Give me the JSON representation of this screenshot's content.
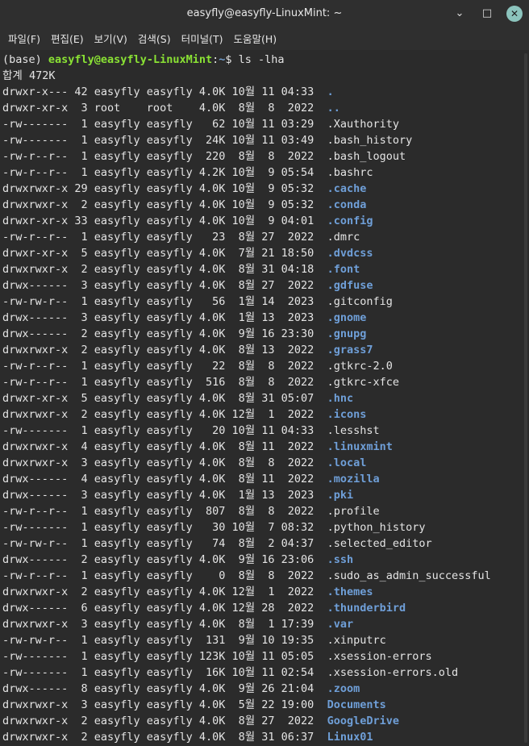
{
  "window": {
    "title": "easyfly@easyfly-LinuxMint: ~",
    "minimize_glyph": "⌄",
    "maximize_glyph": "□",
    "close_glyph": "✕"
  },
  "menu": [
    "파일(F)",
    "편집(E)",
    "보기(V)",
    "검색(S)",
    "터미널(T)",
    "도움말(H)"
  ],
  "prompt": {
    "env": "(base) ",
    "userhost": "easyfly@easyfly-LinuxMint",
    "colon": ":",
    "path": "~",
    "dollar": "$ ",
    "command": "ls -lha"
  },
  "total": "합계 472K",
  "colors": {
    "dir": "#6f9fd8",
    "user": "#8ae234",
    "bg": "#2b2b2b",
    "fg": "#e4e4e4"
  },
  "entries": [
    {
      "meta": "drwxr-x--- 42 easyfly easyfly 4.0K 10월 11 04:33  ",
      "name": ".",
      "dir": true
    },
    {
      "meta": "drwxr-xr-x  3 root    root    4.0K  8월  8  2022  ",
      "name": "..",
      "dir": true
    },
    {
      "meta": "-rw-------  1 easyfly easyfly   62 10월 11 03:29  ",
      "name": ".Xauthority",
      "dir": false
    },
    {
      "meta": "-rw-------  1 easyfly easyfly  24K 10월 11 03:49  ",
      "name": ".bash_history",
      "dir": false
    },
    {
      "meta": "-rw-r--r--  1 easyfly easyfly  220  8월  8  2022  ",
      "name": ".bash_logout",
      "dir": false
    },
    {
      "meta": "-rw-r--r--  1 easyfly easyfly 4.2K 10월  9 05:54  ",
      "name": ".bashrc",
      "dir": false
    },
    {
      "meta": "drwxrwxr-x 29 easyfly easyfly 4.0K 10월  9 05:32  ",
      "name": ".cache",
      "dir": true
    },
    {
      "meta": "drwxrwxr-x  2 easyfly easyfly 4.0K 10월  9 05:32  ",
      "name": ".conda",
      "dir": true
    },
    {
      "meta": "drwxr-xr-x 33 easyfly easyfly 4.0K 10월  9 04:01  ",
      "name": ".config",
      "dir": true
    },
    {
      "meta": "-rw-r--r--  1 easyfly easyfly   23  8월 27  2022  ",
      "name": ".dmrc",
      "dir": false
    },
    {
      "meta": "drwxr-xr-x  5 easyfly easyfly 4.0K  7월 21 18:50  ",
      "name": ".dvdcss",
      "dir": true
    },
    {
      "meta": "drwxrwxr-x  2 easyfly easyfly 4.0K  8월 31 04:18  ",
      "name": ".font",
      "dir": true
    },
    {
      "meta": "drwx------  3 easyfly easyfly 4.0K  8월 27  2022  ",
      "name": ".gdfuse",
      "dir": true
    },
    {
      "meta": "-rw-rw-r--  1 easyfly easyfly   56  1월 14  2023  ",
      "name": ".gitconfig",
      "dir": false
    },
    {
      "meta": "drwx------  3 easyfly easyfly 4.0K  1월 13  2023  ",
      "name": ".gnome",
      "dir": true
    },
    {
      "meta": "drwx------  2 easyfly easyfly 4.0K  9월 16 23:30  ",
      "name": ".gnupg",
      "dir": true
    },
    {
      "meta": "drwxrwxr-x  2 easyfly easyfly 4.0K  8월 13  2022  ",
      "name": ".grass7",
      "dir": true
    },
    {
      "meta": "-rw-r--r--  1 easyfly easyfly   22  8월  8  2022  ",
      "name": ".gtkrc-2.0",
      "dir": false
    },
    {
      "meta": "-rw-r--r--  1 easyfly easyfly  516  8월  8  2022  ",
      "name": ".gtkrc-xfce",
      "dir": false
    },
    {
      "meta": "drwxr-xr-x  5 easyfly easyfly 4.0K  8월 31 05:07  ",
      "name": ".hnc",
      "dir": true
    },
    {
      "meta": "drwxrwxr-x  2 easyfly easyfly 4.0K 12월  1  2022  ",
      "name": ".icons",
      "dir": true
    },
    {
      "meta": "-rw-------  1 easyfly easyfly   20 10월 11 04:33  ",
      "name": ".lesshst",
      "dir": false
    },
    {
      "meta": "drwxrwxr-x  4 easyfly easyfly 4.0K  8월 11  2022  ",
      "name": ".linuxmint",
      "dir": true
    },
    {
      "meta": "drwxrwxr-x  3 easyfly easyfly 4.0K  8월  8  2022  ",
      "name": ".local",
      "dir": true
    },
    {
      "meta": "drwx------  4 easyfly easyfly 4.0K  8월 11  2022  ",
      "name": ".mozilla",
      "dir": true
    },
    {
      "meta": "drwx------  3 easyfly easyfly 4.0K  1월 13  2023  ",
      "name": ".pki",
      "dir": true
    },
    {
      "meta": "-rw-r--r--  1 easyfly easyfly  807  8월  8  2022  ",
      "name": ".profile",
      "dir": false
    },
    {
      "meta": "-rw-------  1 easyfly easyfly   30 10월  7 08:32  ",
      "name": ".python_history",
      "dir": false
    },
    {
      "meta": "-rw-rw-r--  1 easyfly easyfly   74  8월  2 04:37  ",
      "name": ".selected_editor",
      "dir": false
    },
    {
      "meta": "drwx------  2 easyfly easyfly 4.0K  9월 16 23:06  ",
      "name": ".ssh",
      "dir": true
    },
    {
      "meta": "-rw-r--r--  1 easyfly easyfly    0  8월  8  2022  ",
      "name": ".sudo_as_admin_successful",
      "dir": false
    },
    {
      "meta": "drwxrwxr-x  2 easyfly easyfly 4.0K 12월  1  2022  ",
      "name": ".themes",
      "dir": true
    },
    {
      "meta": "drwx------  6 easyfly easyfly 4.0K 12월 28  2022  ",
      "name": ".thunderbird",
      "dir": true
    },
    {
      "meta": "drwxrwxr-x  3 easyfly easyfly 4.0K  8월  1 17:39  ",
      "name": ".var",
      "dir": true
    },
    {
      "meta": "-rw-rw-r--  1 easyfly easyfly  131  9월 10 19:35  ",
      "name": ".xinputrc",
      "dir": false
    },
    {
      "meta": "-rw-------  1 easyfly easyfly 123K 10월 11 05:05  ",
      "name": ".xsession-errors",
      "dir": false
    },
    {
      "meta": "-rw-------  1 easyfly easyfly  16K 10월 11 02:54  ",
      "name": ".xsession-errors.old",
      "dir": false
    },
    {
      "meta": "drwx------  8 easyfly easyfly 4.0K  9월 26 21:04  ",
      "name": ".zoom",
      "dir": true
    },
    {
      "meta": "drwxrwxr-x  3 easyfly easyfly 4.0K  5월 22 19:00  ",
      "name": "Documents",
      "dir": true
    },
    {
      "meta": "drwxrwxr-x  2 easyfly easyfly 4.0K  8월 27  2022  ",
      "name": "GoogleDrive",
      "dir": true
    },
    {
      "meta": "drwxrwxr-x  2 easyfly easyfly 4.0K  8월 31 06:37  ",
      "name": "Linux01",
      "dir": true
    }
  ]
}
